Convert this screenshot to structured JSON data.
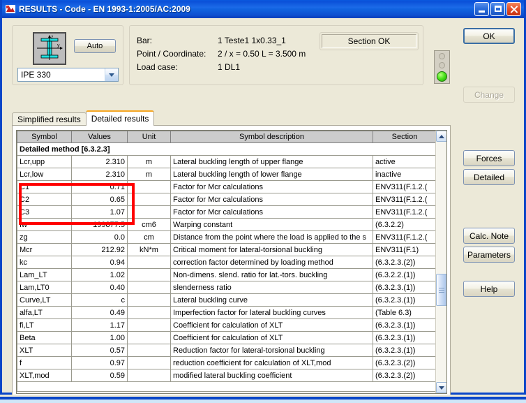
{
  "window": {
    "title": "RESULTS - Code - EN 1993-1:2005/AC:2009",
    "icon": "app-icon",
    "minimize_label": "Minimize",
    "maximize_label": "Maximize",
    "close_label": "Close"
  },
  "section_panel": {
    "auto_button": "Auto",
    "profile_value": "IPE 330",
    "shape_axis_z": "z",
    "shape_axis_y": "y"
  },
  "info_panel": {
    "rows": [
      {
        "label": "Bar:",
        "value": "1  Teste1 1x0.33_1"
      },
      {
        "label": "Point / Coordinate:",
        "value": "2 / x = 0.50 L = 3.500 m"
      },
      {
        "label": "Load case:",
        "value": "1 DL1"
      }
    ],
    "status_box": "Section OK"
  },
  "tabs": [
    {
      "label": "Simplified results",
      "active": false
    },
    {
      "label": "Detailed results",
      "active": true
    }
  ],
  "table": {
    "headers": [
      "Symbol",
      "Values",
      "Unit",
      "Symbol description",
      "Section"
    ],
    "rows": [
      {
        "type": "section",
        "symbol": "Detailed method [6.3.2.3]"
      },
      {
        "type": "data",
        "symbol": "Lcr,upp",
        "value": "2.310",
        "unit": "m",
        "desc": "Lateral buckling length of upper flange",
        "section": "active"
      },
      {
        "type": "data",
        "symbol": "Lcr,low",
        "value": "2.310",
        "unit": "m",
        "desc": "Lateral buckling length of lower flange",
        "section": "inactive"
      },
      {
        "type": "data",
        "symbol": "C1",
        "value": "0.71",
        "unit": "",
        "desc": "Factor for Mcr calculations",
        "section": "ENV311(F.1.2.("
      },
      {
        "type": "data",
        "symbol": "C2",
        "value": "0.65",
        "unit": "",
        "desc": "Factor for Mcr calculations",
        "section": "ENV311(F.1.2.("
      },
      {
        "type": "data",
        "symbol": "C3",
        "value": "1.07",
        "unit": "",
        "desc": "Factor for Mcr calculations",
        "section": "ENV311(F.1.2.("
      },
      {
        "type": "data",
        "symbol": "Iw",
        "value": "199877.5",
        "unit": "cm6",
        "desc": "Warping constant",
        "section": "(6.3.2.2)"
      },
      {
        "type": "data",
        "symbol": "zg",
        "value": "0.0",
        "unit": "cm",
        "desc": "Distance from the point where the load is applied to the s",
        "section": "ENV311(F.1.2.("
      },
      {
        "type": "data",
        "symbol": "Mcr",
        "value": "212.92",
        "unit": "kN*m",
        "desc": "Critical moment for lateral-torsional buckling",
        "section": "ENV311(F.1)"
      },
      {
        "type": "data",
        "symbol": "kc",
        "value": "0.94",
        "unit": "",
        "desc": "correction factor determined by loading method",
        "section": "(6.3.2.3.(2))"
      },
      {
        "type": "data",
        "symbol": "Lam_LT",
        "value": "1.02",
        "unit": "",
        "desc": "Non-dimens. slend. ratio for lat.-tors. buckling",
        "section": "(6.3.2.2.(1))"
      },
      {
        "type": "data",
        "symbol": "Lam,LT0",
        "value": "0.40",
        "unit": "",
        "desc": "slenderness ratio",
        "section": "(6.3.2.3.(1))"
      },
      {
        "type": "data",
        "symbol": "Curve,LT",
        "value": "c",
        "unit": "",
        "desc": "Lateral buckling curve",
        "section": "(6.3.2.3.(1))"
      },
      {
        "type": "data",
        "symbol": "alfa,LT",
        "value": "0.49",
        "unit": "",
        "desc": "Imperfection factor for lateral buckling curves",
        "section": "(Table 6.3)"
      },
      {
        "type": "data",
        "symbol": "fi,LT",
        "value": "1.17",
        "unit": "",
        "desc": "Coefficient for calculation of XLT",
        "section": "(6.3.2.3.(1))"
      },
      {
        "type": "data",
        "symbol": "Beta",
        "value": "1.00",
        "unit": "",
        "desc": "Coefficient for calculation of XLT",
        "section": "(6.3.2.3.(1))"
      },
      {
        "type": "data",
        "symbol": "XLT",
        "value": "0.57",
        "unit": "",
        "desc": "Reduction factor for lateral-torsional buckling",
        "section": "(6.3.2.3.(1))"
      },
      {
        "type": "data",
        "symbol": "f",
        "value": "0.97",
        "unit": "",
        "desc": "reduction coefficient for calculation of XLT,mod",
        "section": "(6.3.2.3.(2))"
      },
      {
        "type": "data",
        "symbol": "XLT,mod",
        "value": "0.59",
        "unit": "",
        "desc": "modified lateral buckling coefficient",
        "section": "(6.3.2.3.(2))"
      },
      {
        "type": "partial",
        "symbol": ""
      }
    ]
  },
  "buttons": {
    "ok": "OK",
    "change": "Change",
    "forces": "Forces",
    "detailed": "Detailed",
    "calc_note": "Calc. Note",
    "parameters": "Parameters",
    "help": "Help"
  },
  "colors": {
    "titlebar": "#1163e0",
    "highlight": "#ff0000",
    "tab_accent": "#f5a623",
    "lamp_ok": "#49e21b",
    "dialog_bg": "#ece9d8"
  }
}
